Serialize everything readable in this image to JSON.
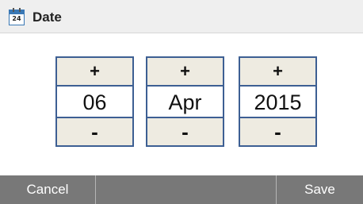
{
  "header": {
    "icon": "calendar-icon",
    "icon_day": "24",
    "title": "Date"
  },
  "spinners": [
    {
      "field": "day",
      "increment_label": "+",
      "value": "06",
      "decrement_label": "-"
    },
    {
      "field": "month",
      "increment_label": "+",
      "value": "Apr",
      "decrement_label": "-"
    },
    {
      "field": "year",
      "increment_label": "+",
      "value": "2015",
      "decrement_label": "-"
    }
  ],
  "footer": {
    "cancel_label": "Cancel",
    "save_label": "Save"
  },
  "colors": {
    "header_bg": "#efefef",
    "spinner_border": "#3d5f93",
    "spinner_button_bg": "#eeebe1",
    "footer_bg": "#787878",
    "icon_accent": "#3a78b5"
  }
}
